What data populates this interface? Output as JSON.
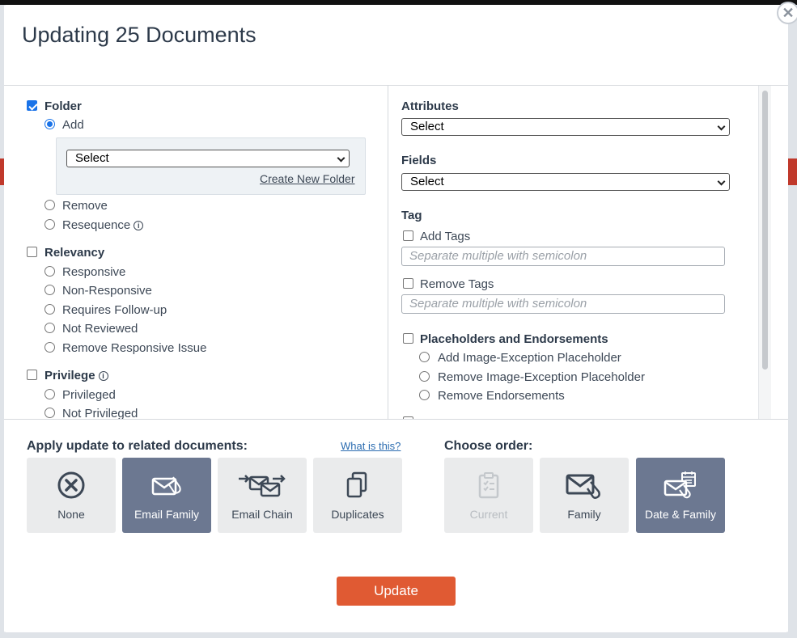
{
  "modal": {
    "title": "Updating 25 Documents",
    "close_glyph": "✕"
  },
  "left": {
    "folder": {
      "label": "Folder",
      "checked": true,
      "add_label": "Add",
      "select_value": "Select",
      "create_link": "Create New Folder",
      "remove_label": "Remove",
      "resequence_label": "Resequence"
    },
    "relevancy": {
      "label": "Relevancy",
      "options": [
        "Responsive",
        "Non-Responsive",
        "Requires Follow-up",
        "Not Reviewed",
        "Remove Responsive Issue"
      ]
    },
    "privilege": {
      "label": "Privilege",
      "options": [
        "Privileged",
        "Not Privileged"
      ]
    }
  },
  "right": {
    "attributes": {
      "label": "Attributes",
      "select_value": "Select"
    },
    "fields": {
      "label": "Fields",
      "select_value": "Select"
    },
    "tag": {
      "label": "Tag",
      "add_label": "Add Tags",
      "add_placeholder": "Separate multiple with semicolon",
      "remove_label": "Remove Tags",
      "remove_placeholder": "Separate multiple with semicolon"
    },
    "placeholders": {
      "label": "Placeholders and Endorsements",
      "options": [
        "Add Image-Exception Placeholder",
        "Remove Image-Exception Placeholder",
        "Remove Endorsements"
      ]
    }
  },
  "related": {
    "title": "Apply update to related documents:",
    "help_link": "What is this?",
    "tiles": [
      {
        "label": "None",
        "icon": "circle-x-icon",
        "selected": false
      },
      {
        "label": "Email Family",
        "icon": "email-attachment-icon",
        "selected": true
      },
      {
        "label": "Email Chain",
        "icon": "email-chain-icon",
        "selected": false
      },
      {
        "label": "Duplicates",
        "icon": "duplicate-icon",
        "selected": false
      }
    ]
  },
  "order": {
    "title": "Choose order:",
    "tiles": [
      {
        "label": "Current",
        "icon": "clipboard-icon",
        "selected": false,
        "disabled": true
      },
      {
        "label": "Family",
        "icon": "email-attachment-icon",
        "selected": false
      },
      {
        "label": "Date & Family",
        "icon": "email-calendar-icon",
        "selected": true
      }
    ]
  },
  "footer": {
    "update_label": "Update"
  },
  "colors": {
    "accent": "#e05a33",
    "selected_tile": "#6c7891",
    "checkbox": "#1a73e8"
  }
}
